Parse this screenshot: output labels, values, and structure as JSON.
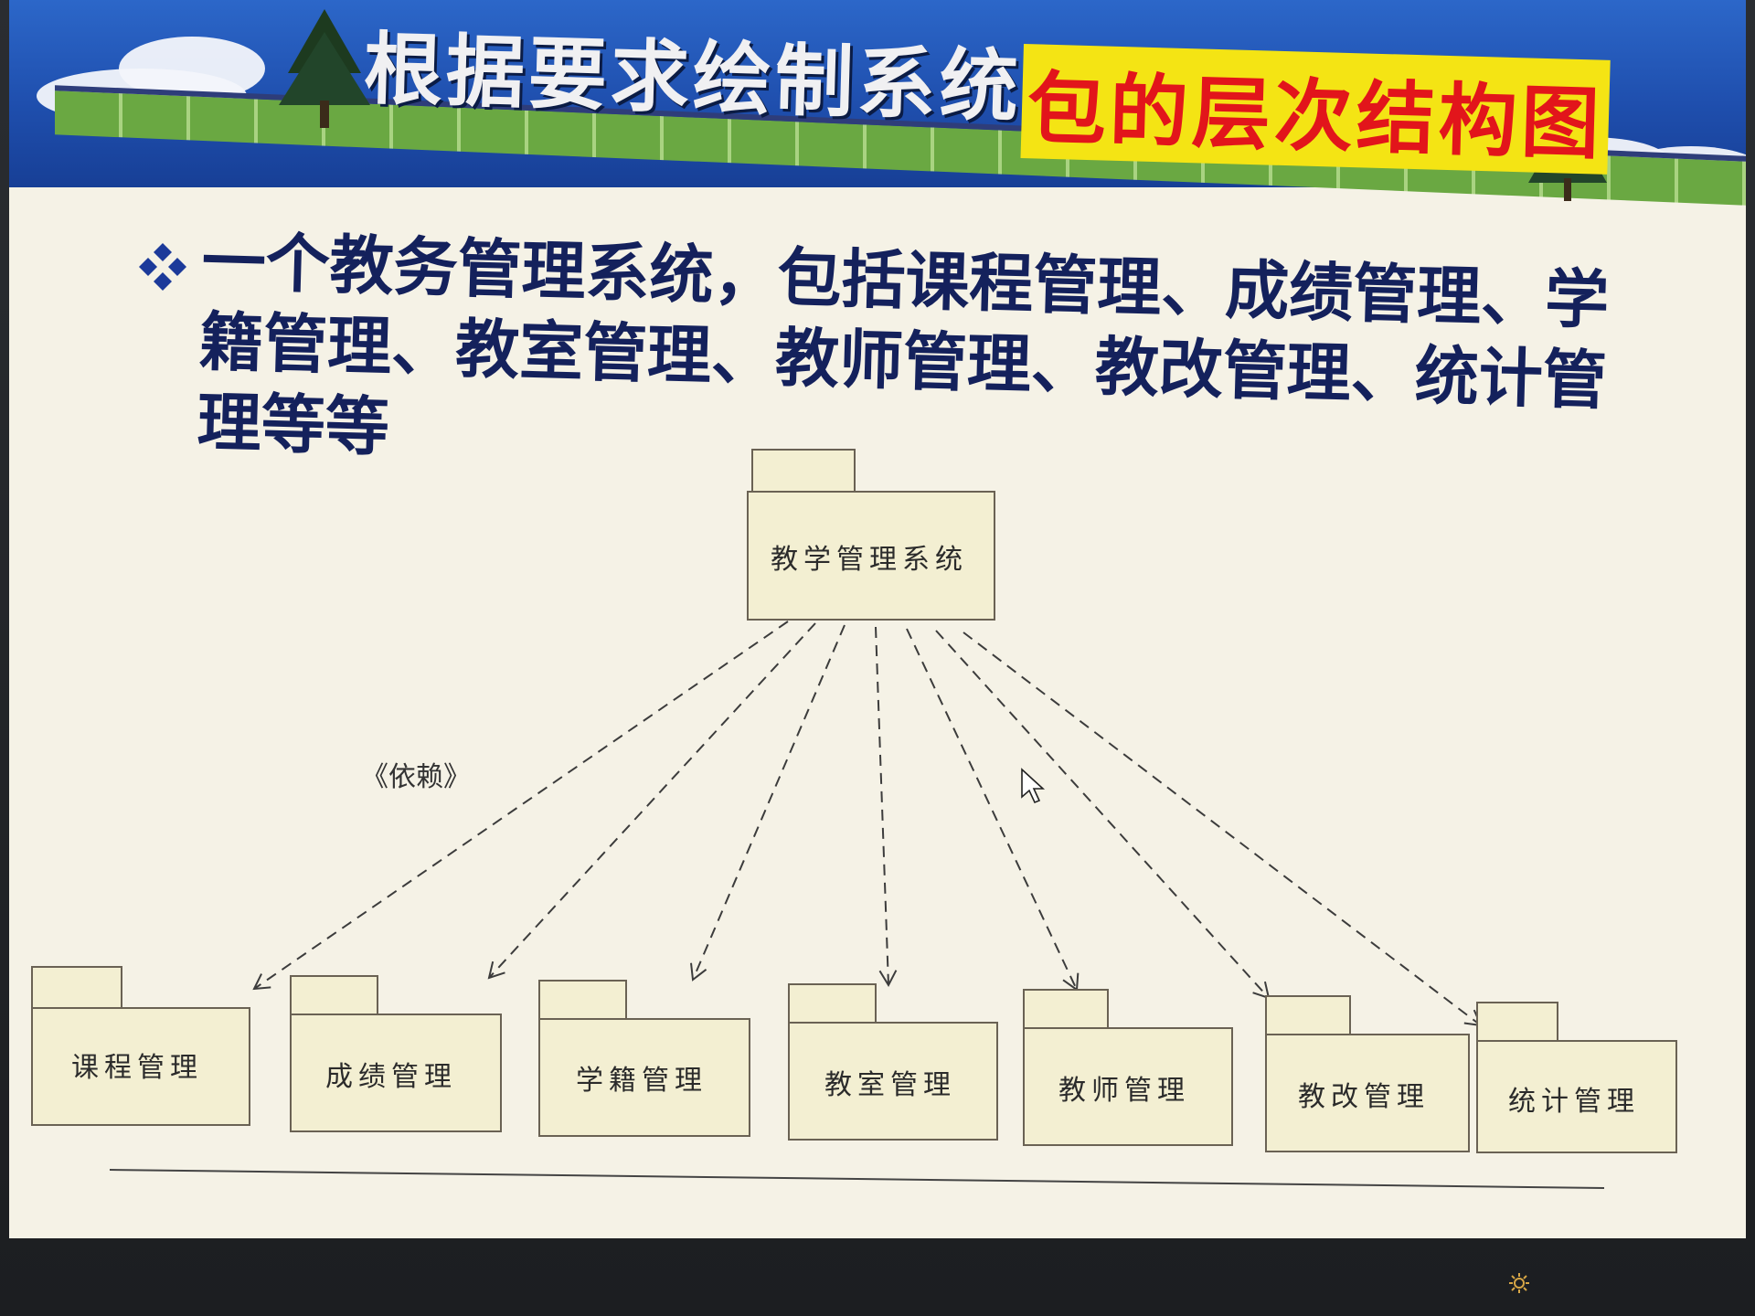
{
  "slide": {
    "title_main": "根据要求绘制系统",
    "title_highlight": "包的层次结构图",
    "bullet_text": "一个教务管理系统，包括课程管理、成绩管理、学籍管理、教室管理、教师管理、教改管理、统计管理等等"
  },
  "diagram": {
    "root_package": "教学管理系统",
    "dependency_stereotype": "《依赖》",
    "child_packages": [
      "课程管理",
      "成绩管理",
      "学籍管理",
      "教室管理",
      "教师管理",
      "教改管理",
      "统计管理"
    ]
  },
  "colors": {
    "banner_blue": "#1f4fae",
    "title_highlight_bg": "#f4e414",
    "title_highlight_text": "#e2151b",
    "bullet_text": "#14215c",
    "package_fill": "#f3efd2"
  },
  "icons": {
    "bullet": "four-diamond-bullet-icon",
    "cursor": "mouse-pointer-icon"
  }
}
